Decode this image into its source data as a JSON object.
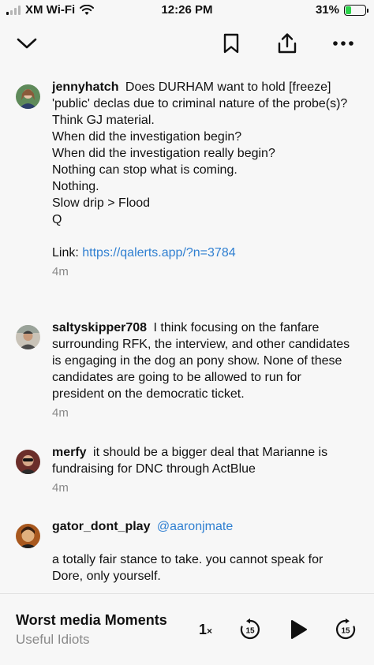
{
  "status_bar": {
    "carrier": "XM Wi-Fi",
    "time": "12:26 PM",
    "battery": "31%",
    "battery_level": 0.31
  },
  "toolbar": {
    "icons": [
      "chevron-down-icon",
      "bookmark-icon",
      "share-icon",
      "more-icon"
    ]
  },
  "comments": [
    {
      "username": "jennyhatch",
      "mention": "",
      "text": "Does DURHAM want to hold [freeze] 'public' declas due to criminal nature of the probe(s)?\nThink GJ material.\nWhen did the investigation begin?\nWhen did the investigation really begin?\nNothing can stop what is coming.\nNothing.\nSlow drip > Flood\nQ\n\nLink: ",
      "link": "https://qalerts.app/?n=3784",
      "time": "4m"
    },
    {
      "username": "saltyskipper708",
      "mention": "",
      "text": "I think focusing on the fanfare surrounding RFK, the interview, and other candidates is engaging in the dog an pony show. None of these candidates are going to be allowed to run for president on the democratic ticket.",
      "link": "",
      "time": "4m"
    },
    {
      "username": "merfy",
      "mention": "",
      "text": "it should be a bigger deal that Marianne is fundraising for DNC through ActBlue",
      "link": "",
      "time": "4m"
    },
    {
      "username": "gator_dont_play",
      "mention": "@aaronjmate",
      "text": "\n\na totally fair stance to take. you cannot speak for Dore, only yourself.",
      "link": "",
      "time": ""
    }
  ],
  "player": {
    "title": "Worst media Moments",
    "subtitle": "Useful Idiots",
    "speed": "1",
    "speed_unit": "×",
    "skip_back": "15",
    "skip_forward": "15"
  }
}
